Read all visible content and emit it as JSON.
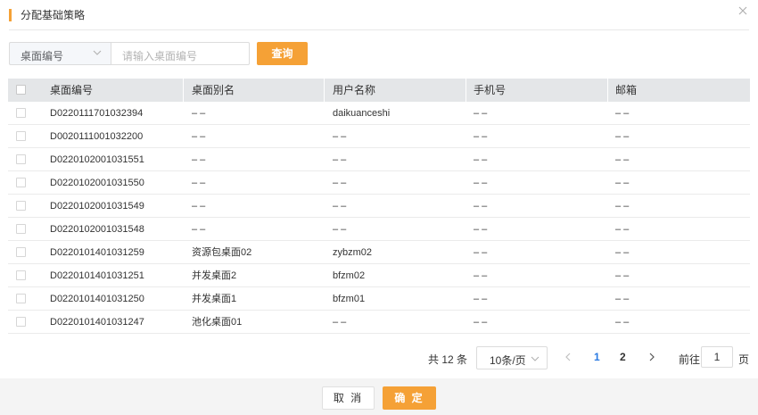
{
  "dialog": {
    "title": "分配基础策略",
    "close_icon": "close-icon"
  },
  "search": {
    "field_label": "桌面编号",
    "placeholder": "请输入桌面编号",
    "button": "查询"
  },
  "table": {
    "columns": [
      "桌面编号",
      "桌面别名",
      "用户名称",
      "手机号",
      "邮箱"
    ],
    "rows": [
      {
        "id": "D0220111701032394",
        "alias": "– –",
        "user": "daikuanceshi",
        "phone": "– –",
        "email": "– –"
      },
      {
        "id": "D0020111001032200",
        "alias": "– –",
        "user": "– –",
        "phone": "– –",
        "email": "– –"
      },
      {
        "id": "D0220102001031551",
        "alias": "– –",
        "user": "– –",
        "phone": "– –",
        "email": "– –"
      },
      {
        "id": "D0220102001031550",
        "alias": "– –",
        "user": "– –",
        "phone": "– –",
        "email": "– –"
      },
      {
        "id": "D0220102001031549",
        "alias": "– –",
        "user": "– –",
        "phone": "– –",
        "email": "– –"
      },
      {
        "id": "D0220102001031548",
        "alias": "– –",
        "user": "– –",
        "phone": "– –",
        "email": "– –"
      },
      {
        "id": "D0220101401031259",
        "alias": "资源包桌面02",
        "user": "zybzm02",
        "phone": "– –",
        "email": "– –"
      },
      {
        "id": "D0220101401031251",
        "alias": "并发桌面2",
        "user": "bfzm02",
        "phone": "– –",
        "email": "– –"
      },
      {
        "id": "D0220101401031250",
        "alias": "并发桌面1",
        "user": "bfzm01",
        "phone": "– –",
        "email": "– –"
      },
      {
        "id": "D0220101401031247",
        "alias": "池化桌面01",
        "user": "– –",
        "phone": "– –",
        "email": "– –"
      }
    ]
  },
  "pagination": {
    "total": "共 12 条",
    "page_size": "10条/页",
    "pages": [
      "1",
      "2"
    ],
    "current_page": "1",
    "goto_prefix": "前往",
    "goto_value": "1",
    "goto_suffix": "页"
  },
  "footer": {
    "cancel": "取 消",
    "confirm": "确 定"
  },
  "colors": {
    "accent": "#f5a136",
    "active_page": "#2a7ae2",
    "header_bg": "#e4e6e8",
    "footer_bg": "#f4f4f4"
  }
}
